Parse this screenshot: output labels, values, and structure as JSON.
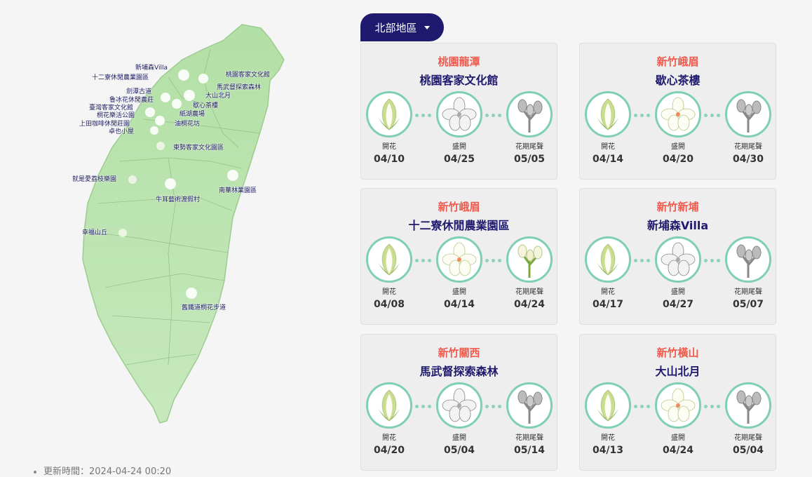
{
  "region_selector": {
    "label": "北部地區",
    "icon": "caret-down-icon"
  },
  "update_time": "更新時間：2024-04-24 00:20",
  "colors": {
    "accent": "#1f1a6e",
    "city": "#ef5a4c",
    "circle_border": "#7fcfb3",
    "map_fill": "#a8dca0"
  },
  "map_labels": [
    "新埔森Villa",
    "十二寮休閒農業園區",
    "桃園客家文化館",
    "馬武督探索森林",
    "大山北月",
    "劍潭古道",
    "魯冰花休閒農莊",
    "臺灣客家文化館",
    "桐花樂活公園",
    "上田咖啡休閒莊園",
    "卓也小屋",
    "歇心茶樓",
    "紙湖農場",
    "油桐花坊",
    "東勢客家文化園區",
    "就是愛荔枝樂園",
    "牛耳藝術渡假村",
    "南華林業園區",
    "幸福山丘",
    "舊鐵道桐花步道"
  ],
  "stage_labels": [
    "開花",
    "盛開",
    "花期尾聲"
  ],
  "cards": [
    {
      "city": "桃園龍潭",
      "place": "桃園客家文化館",
      "dates": [
        "04/10",
        "04/25",
        "05/05"
      ],
      "states": [
        "color",
        "gray",
        "gray"
      ]
    },
    {
      "city": "新竹峨眉",
      "place": "歇心茶樓",
      "dates": [
        "04/14",
        "04/20",
        "04/30"
      ],
      "states": [
        "color",
        "color",
        "gray"
      ]
    },
    {
      "city": "新竹峨眉",
      "place": "十二寮休閒農業園區",
      "dates": [
        "04/08",
        "04/14",
        "04/24"
      ],
      "states": [
        "color",
        "color",
        "color"
      ]
    },
    {
      "city": "新竹新埔",
      "place": "新埔森Villa",
      "dates": [
        "04/17",
        "04/27",
        "05/07"
      ],
      "states": [
        "color",
        "gray",
        "gray"
      ]
    },
    {
      "city": "新竹關西",
      "place": "馬武督探索森林",
      "dates": [
        "04/20",
        "05/04",
        "05/14"
      ],
      "states": [
        "color",
        "gray",
        "gray"
      ]
    },
    {
      "city": "新竹橫山",
      "place": "大山北月",
      "dates": [
        "04/13",
        "04/24",
        "05/04"
      ],
      "states": [
        "color",
        "color",
        "gray"
      ]
    }
  ]
}
